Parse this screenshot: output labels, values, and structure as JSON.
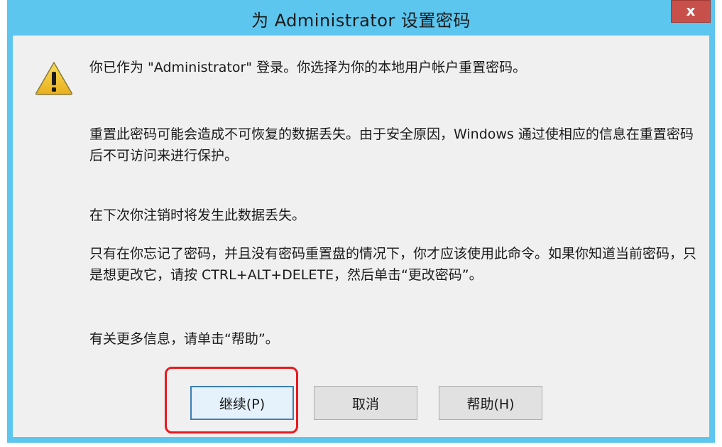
{
  "window": {
    "title": "为 Administrator 设置密码",
    "close_label": "x"
  },
  "icon": {
    "name": "warning-icon",
    "color": "#f2c22a"
  },
  "messages": [
    "你已作为 \"Administrator\" 登录。你选择为你的本地用户帐户重置密码。",
    "重置此密码可能会造成不可恢复的数据丢失。由于安全原因，Windows 通过使相应的信息在重置密码后不可访问来进行保护。",
    "在下次你注销时将发生此数据丢失。",
    "只有在你忘记了密码，并且没有密码重置盘的情况下，你才应该使用此命令。如果你知道当前密码，只是想更改它，请按 CTRL+ALT+DELETE，然后单击“更改密码”。",
    "有关更多信息，请单击“帮助”。"
  ],
  "buttons": {
    "continue": "继续(P)",
    "cancel": "取消",
    "help": "帮助(H)"
  },
  "colors": {
    "titlebar": "#5cc6ee",
    "close_button": "#c7504a",
    "highlight": "#e8191f"
  }
}
